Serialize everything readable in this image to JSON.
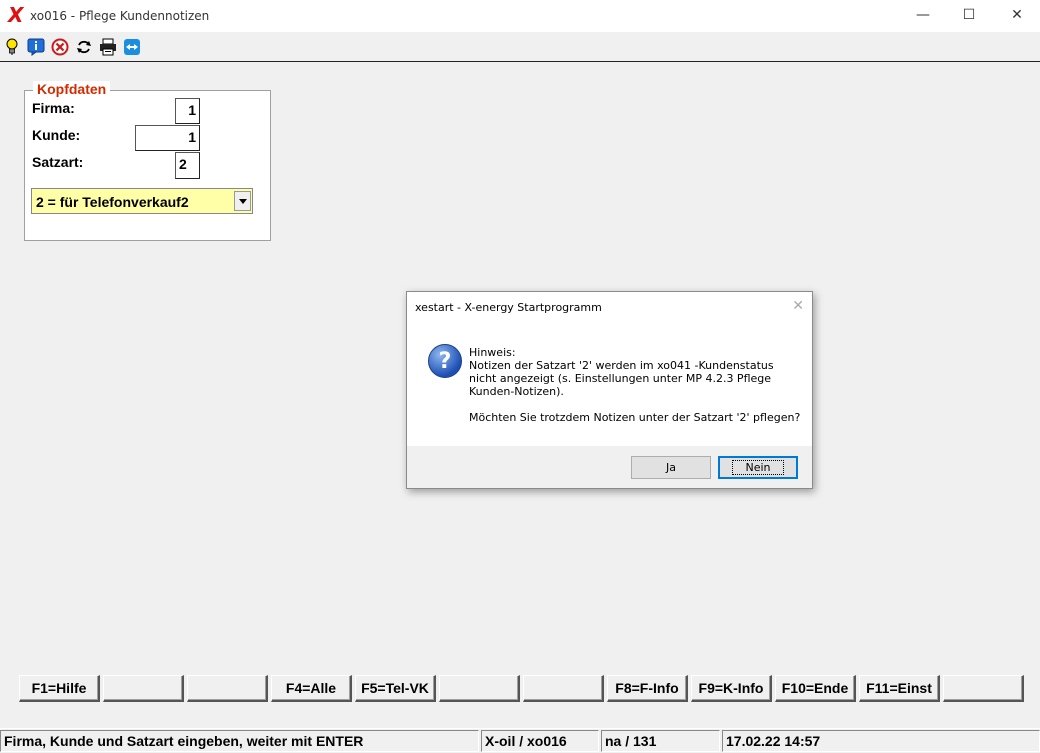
{
  "window": {
    "logo": "X",
    "title": "xo016 - Pflege Kundennotizen",
    "min": "—",
    "max": "☐",
    "close": "✕"
  },
  "toolbar": {
    "icons": [
      "lightbulb-icon",
      "info-icon",
      "cancel-icon",
      "refresh-icon",
      "printer-icon",
      "remote-support-icon"
    ]
  },
  "kopfdaten": {
    "legend": "Kopfdaten",
    "firma_label": "Firma:",
    "firma_value": "1",
    "kunde_label": "Kunde:",
    "kunde_value": "1",
    "satzart_label": "Satzart:",
    "satzart_value": "2",
    "satzart_selected": "2 = für Telefonverkauf2"
  },
  "dialog": {
    "title": "xestart - X-energy Startprogramm",
    "close": "✕",
    "icon": "?",
    "message_line1": "Hinweis:",
    "message_line2": "Notizen der Satzart '2' werden im xo041 -Kundenstatus nicht angezeigt (s. Einstellungen unter MP 4.2.3 Pflege Kunden-Notizen).",
    "question": "Möchten Sie trotzdem Notizen unter der Satzart '2' pflegen?",
    "yes_label": "Ja",
    "no_label": "Nein"
  },
  "function_keys": [
    "F1=Hilfe",
    "",
    "",
    "F4=Alle",
    "F5=Tel-VK",
    "",
    "",
    "F8=F-Info",
    "F9=K-Info",
    "F10=Ende",
    "F11=Einst",
    ""
  ],
  "statusbar": {
    "message": "Firma, Kunde und Satzart eingeben, weiter mit ENTER",
    "program": "X-oil / xo016",
    "user": "na / 131",
    "datetime": "17.02.22 14:57"
  },
  "colors": {
    "accent_red": "#d42a00",
    "select_bg": "#ffffa8",
    "focus_blue": "#0078d7"
  }
}
